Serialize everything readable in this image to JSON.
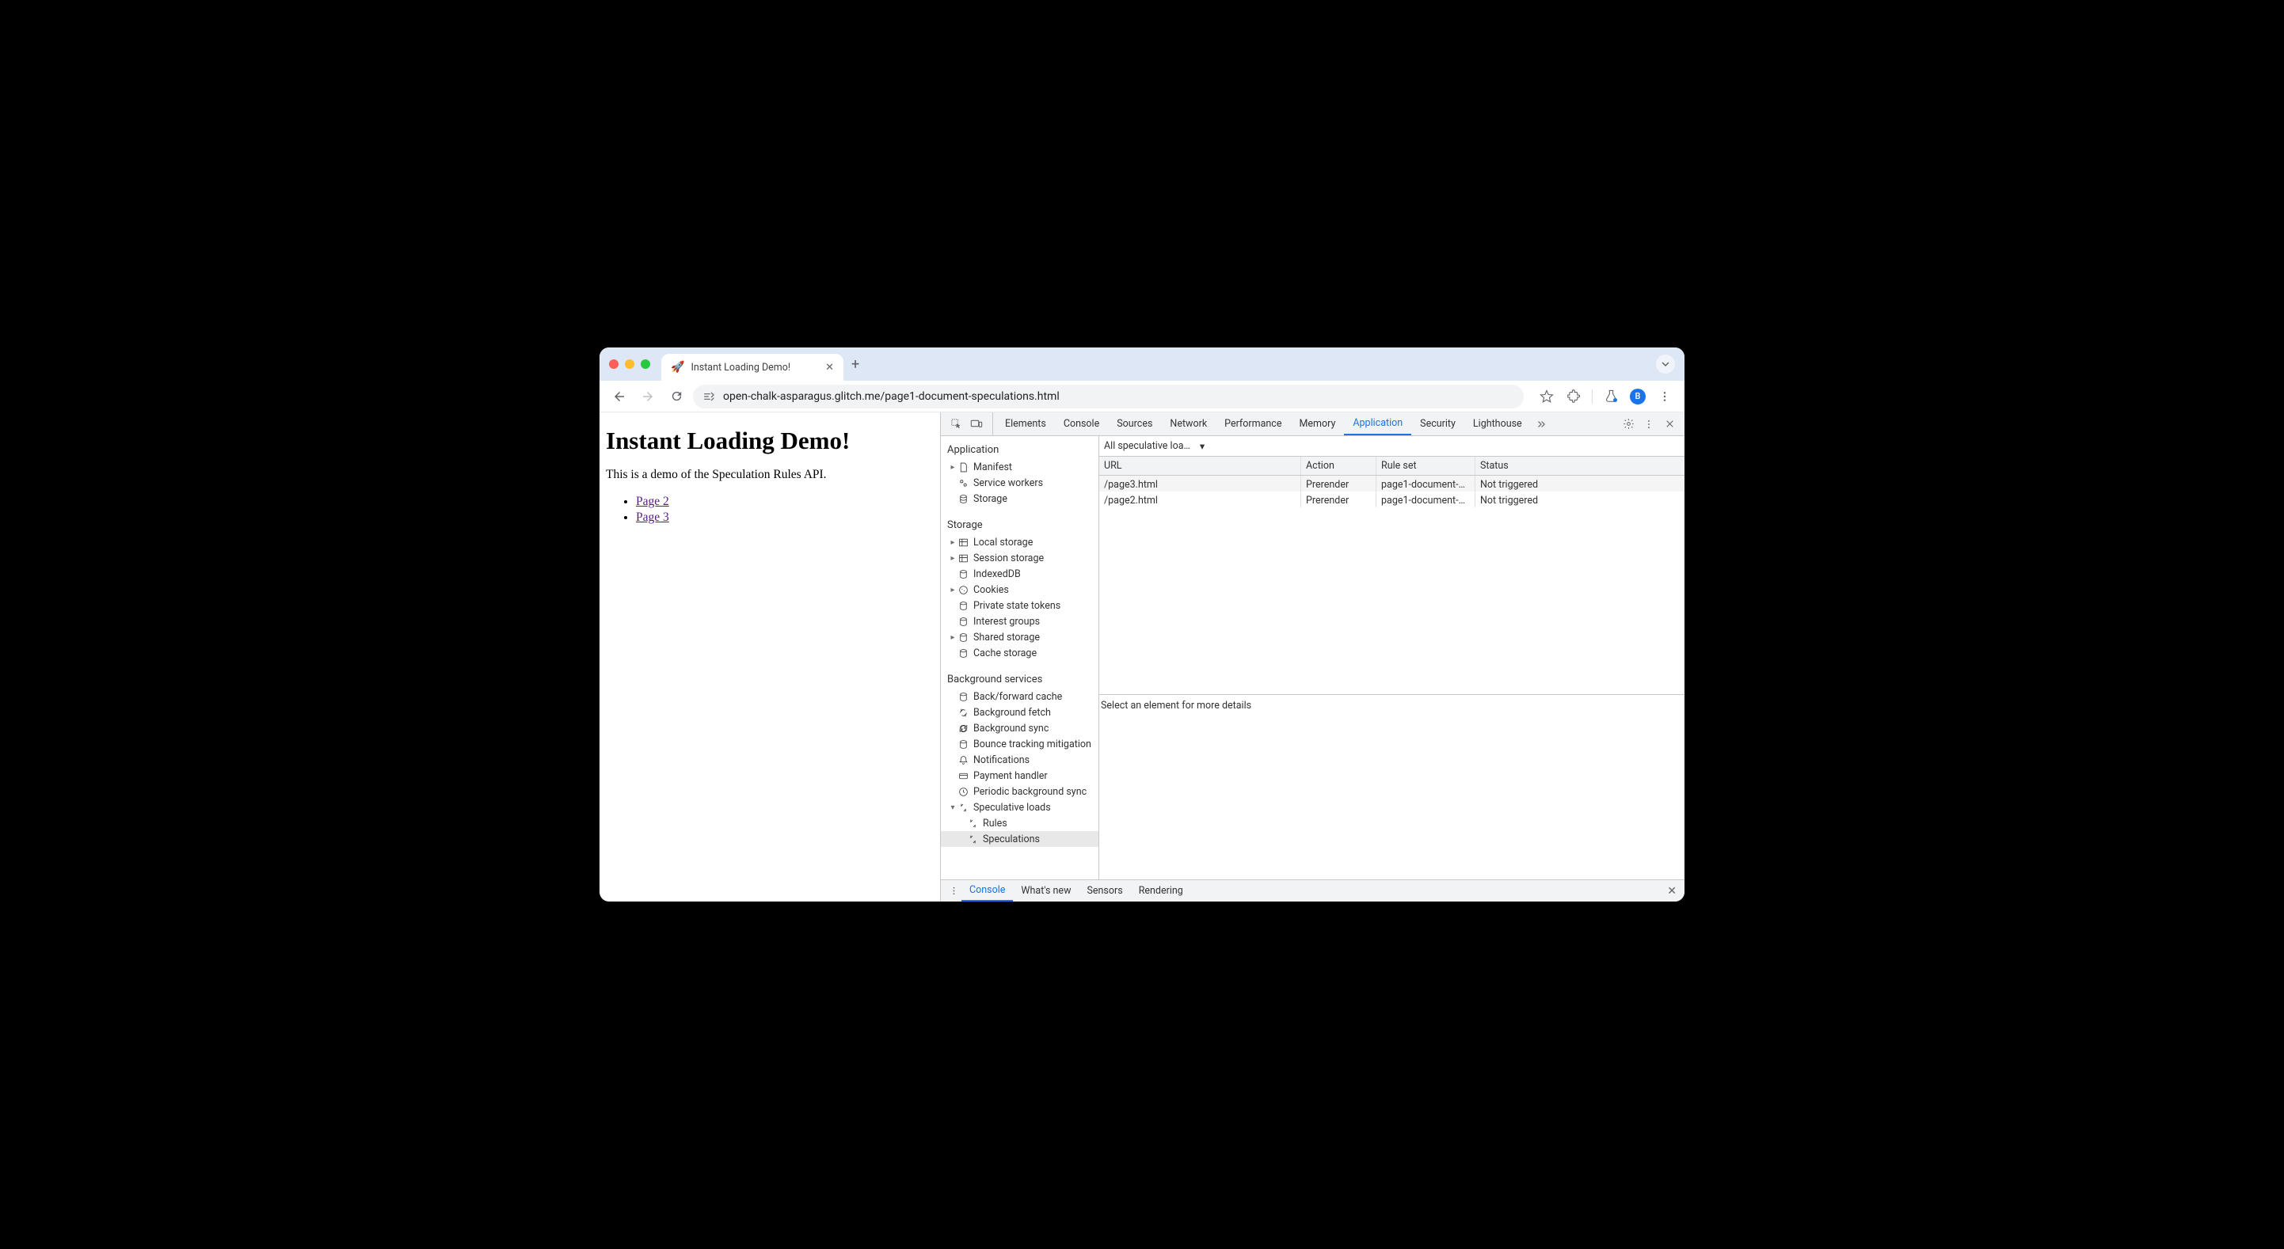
{
  "tab": {
    "title": "Instant Loading Demo!",
    "favicon": "🚀"
  },
  "toolbar": {
    "url": "open-chalk-asparagus.glitch.me/page1-document-speculations.html",
    "avatar_letter": "B"
  },
  "page": {
    "heading": "Instant Loading Demo!",
    "intro": "This is a demo of the Speculation Rules API.",
    "links": [
      {
        "text": "Page 2"
      },
      {
        "text": "Page 3"
      }
    ]
  },
  "devtools": {
    "tabs": [
      "Elements",
      "Console",
      "Sources",
      "Network",
      "Performance",
      "Memory",
      "Application",
      "Security",
      "Lighthouse"
    ],
    "active_tab": "Application",
    "sidebar": {
      "application": {
        "heading": "Application",
        "items": [
          "Manifest",
          "Service workers",
          "Storage"
        ]
      },
      "storage": {
        "heading": "Storage",
        "items": [
          "Local storage",
          "Session storage",
          "IndexedDB",
          "Cookies",
          "Private state tokens",
          "Interest groups",
          "Shared storage",
          "Cache storage"
        ]
      },
      "background": {
        "heading": "Background services",
        "items": [
          "Back/forward cache",
          "Background fetch",
          "Background sync",
          "Bounce tracking mitigation",
          "Notifications",
          "Payment handler",
          "Periodic background sync",
          "Speculative loads"
        ],
        "speculative_children": [
          "Rules",
          "Speculations"
        ]
      }
    },
    "filter_label": "All speculative loa…",
    "table": {
      "headers": {
        "url": "URL",
        "action": "Action",
        "ruleset": "Rule set",
        "status": "Status"
      },
      "rows": [
        {
          "url": "/page3.html",
          "action": "Prerender",
          "ruleset": "page1-document-…",
          "status": "Not triggered"
        },
        {
          "url": "/page2.html",
          "action": "Prerender",
          "ruleset": "page1-document-…",
          "status": "Not triggered"
        }
      ]
    },
    "detail_empty": "Select an element for more details",
    "drawer_tabs": [
      "Console",
      "What's new",
      "Sensors",
      "Rendering"
    ],
    "drawer_active": "Console"
  }
}
